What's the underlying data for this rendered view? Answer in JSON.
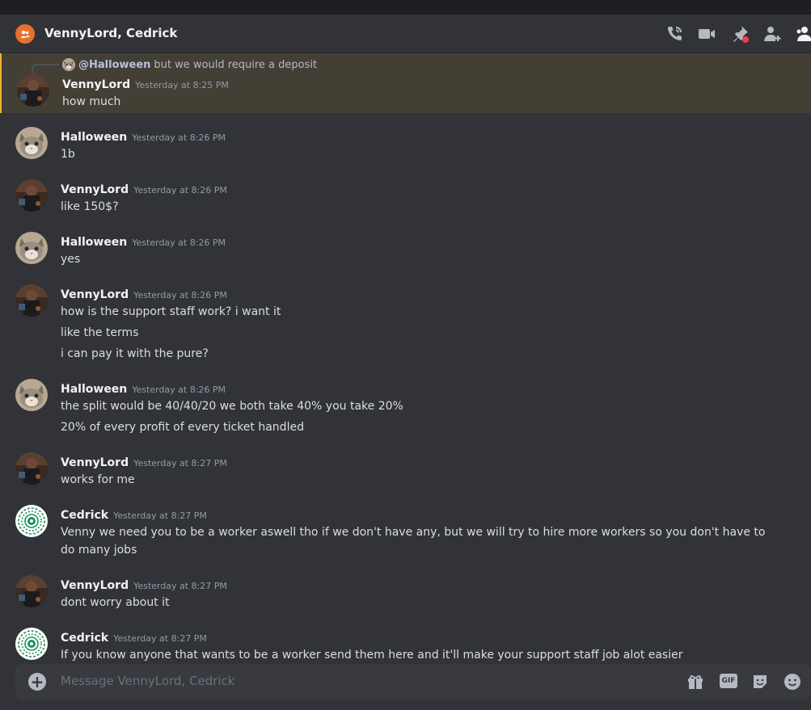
{
  "header": {
    "title": "VennyLord, Cedrick",
    "icons": [
      "phone-call-icon",
      "video-camera-icon",
      "pinned-messages-icon",
      "add-friends-icon",
      "member-list-icon"
    ]
  },
  "reply": {
    "mention": "@Halloween",
    "text": "but we would require a deposit"
  },
  "messages": [
    {
      "author": "VennyLord",
      "timestamp": "Yesterday at 8:25 PM",
      "lines": [
        "how much"
      ],
      "avatar": "vennylord-avatar",
      "highlighted": true
    },
    {
      "author": "Halloween",
      "timestamp": "Yesterday at 8:26 PM",
      "lines": [
        "1b"
      ],
      "avatar": "halloween-cat-avatar"
    },
    {
      "author": "VennyLord",
      "timestamp": "Yesterday at 8:26 PM",
      "lines": [
        "like 150$?"
      ],
      "avatar": "vennylord-avatar"
    },
    {
      "author": "Halloween",
      "timestamp": "Yesterday at 8:26 PM",
      "lines": [
        "yes"
      ],
      "avatar": "halloween-cat-avatar"
    },
    {
      "author": "VennyLord",
      "timestamp": "Yesterday at 8:26 PM",
      "lines": [
        "how is the support staff work? i want it",
        "like the terms",
        "i can pay it with the pure?"
      ],
      "avatar": "vennylord-avatar"
    },
    {
      "author": "Halloween",
      "timestamp": "Yesterday at 8:26 PM",
      "lines": [
        "the split would be 40/40/20 we both take 40%  you take 20%",
        "20% of every profit of every ticket handled"
      ],
      "avatar": "halloween-cat-avatar"
    },
    {
      "author": "VennyLord",
      "timestamp": "Yesterday at 8:27 PM",
      "lines": [
        "works for me"
      ],
      "avatar": "vennylord-avatar"
    },
    {
      "author": "Cedrick",
      "timestamp": "Yesterday at 8:27 PM",
      "lines": [
        "Venny we need you to be a worker aswell tho if we don't have any, but we will try to hire more workers so you don't have to do many jobs"
      ],
      "avatar": "cedrick-mandala-avatar"
    },
    {
      "author": "VennyLord",
      "timestamp": "Yesterday at 8:27 PM",
      "lines": [
        "dont worry about it"
      ],
      "avatar": "vennylord-avatar"
    },
    {
      "author": "Cedrick",
      "timestamp": "Yesterday at 8:27 PM",
      "lines": [
        "If you know anyone that wants to be a worker send them here and it'll make your support staff job alot easier"
      ],
      "avatar": "cedrick-mandala-avatar"
    }
  ],
  "composer": {
    "placeholder": "Message VennyLord, Cedrick",
    "gif_label": "GIF",
    "icons": [
      "add-attachment-icon",
      "gift-icon",
      "gif-icon",
      "sticker-icon",
      "emoji-icon"
    ]
  },
  "colors": {
    "background": "#313338",
    "header_bg": "#313338",
    "composer_bg": "#383a40",
    "highlight_bg": "#433f35",
    "highlight_bar": "#f0b232",
    "group_icon": "#e8702a",
    "author": "#f2f3f5",
    "timestamp": "#949ba4",
    "text": "#dbdee1"
  }
}
